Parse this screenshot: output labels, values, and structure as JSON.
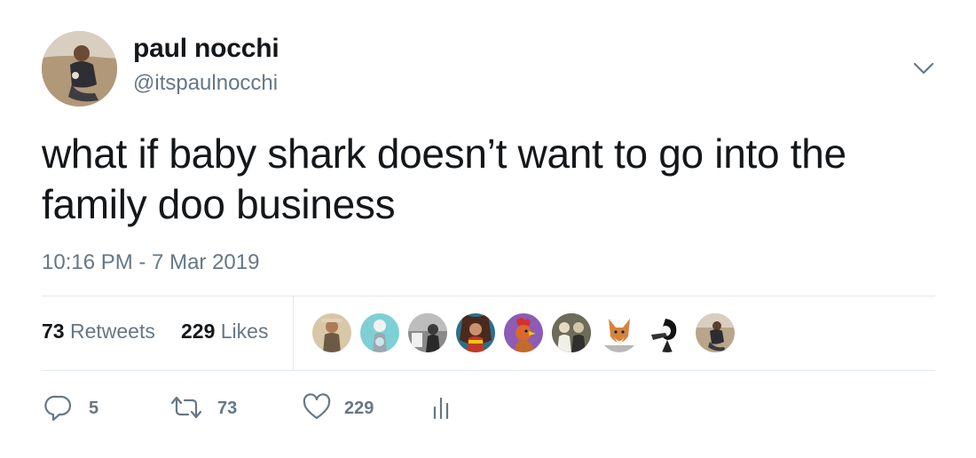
{
  "author": {
    "name": "paul nocchi",
    "handle": "@itspaulnocchi"
  },
  "tweet": {
    "text": "what if baby shark doesn’t want to go into the family doo business",
    "timestamp": "10:16 PM - 7 Mar 2019"
  },
  "stats": {
    "retweets_count": "73",
    "retweets_label": "Retweets",
    "likes_count": "229",
    "likes_label": "Likes"
  },
  "actions": {
    "reply_count": "5",
    "retweet_count": "73",
    "like_count": "229"
  },
  "icons": {
    "menu": "chevron-down-icon",
    "reply": "reply-icon",
    "retweet": "retweet-icon",
    "like": "heart-icon",
    "analytics": "analytics-icon"
  },
  "colors": {
    "text": "#14171a",
    "secondary": "#657786",
    "divider": "#e1e8ed"
  }
}
